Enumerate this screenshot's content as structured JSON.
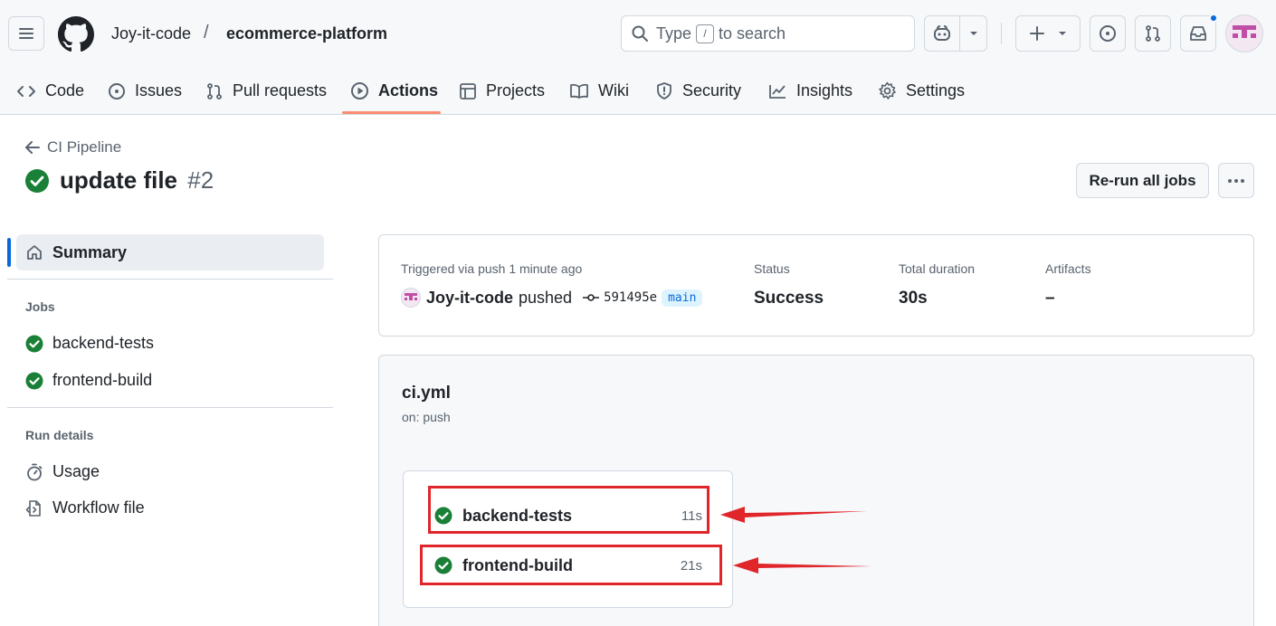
{
  "header": {
    "owner": "Joy-it-code",
    "separator": "/",
    "repo": "ecommerce-platform",
    "search_prefix": "Type",
    "search_key": "/",
    "search_suffix": "to search"
  },
  "nav": {
    "items": [
      {
        "label": "Code",
        "icon": "code-icon"
      },
      {
        "label": "Issues",
        "icon": "issue-opened-icon"
      },
      {
        "label": "Pull requests",
        "icon": "git-pull-request-icon"
      },
      {
        "label": "Actions",
        "icon": "play-icon",
        "active": true
      },
      {
        "label": "Projects",
        "icon": "table-icon"
      },
      {
        "label": "Wiki",
        "icon": "book-icon"
      },
      {
        "label": "Security",
        "icon": "shield-icon"
      },
      {
        "label": "Insights",
        "icon": "graph-icon"
      },
      {
        "label": "Settings",
        "icon": "gear-icon"
      }
    ]
  },
  "run": {
    "back_label": "CI Pipeline",
    "title": "update file",
    "number": "#2",
    "rerun_label": "Re-run all jobs"
  },
  "sidebar": {
    "summary_label": "Summary",
    "jobs_heading": "Jobs",
    "jobs": [
      "backend-tests",
      "frontend-build"
    ],
    "run_details_heading": "Run details",
    "usage_label": "Usage",
    "workflow_file_label": "Workflow file"
  },
  "summary": {
    "trigger_label": "Triggered via push 1 minute ago",
    "actor": "Joy-it-code",
    "action": "pushed",
    "commit": "591495e",
    "branch": "main",
    "status_label": "Status",
    "status_value": "Success",
    "duration_label": "Total duration",
    "duration_value": "30s",
    "artifacts_label": "Artifacts",
    "artifacts_value": "–"
  },
  "workflow": {
    "name": "ci.yml",
    "trigger": "on: push",
    "jobs": [
      {
        "name": "backend-tests",
        "duration": "11s"
      },
      {
        "name": "frontend-build",
        "duration": "21s"
      }
    ]
  },
  "colors": {
    "success": "#1a7f37",
    "accent": "#0969da",
    "annotation": "#e0262b",
    "nav_underline": "#fd8c73"
  }
}
